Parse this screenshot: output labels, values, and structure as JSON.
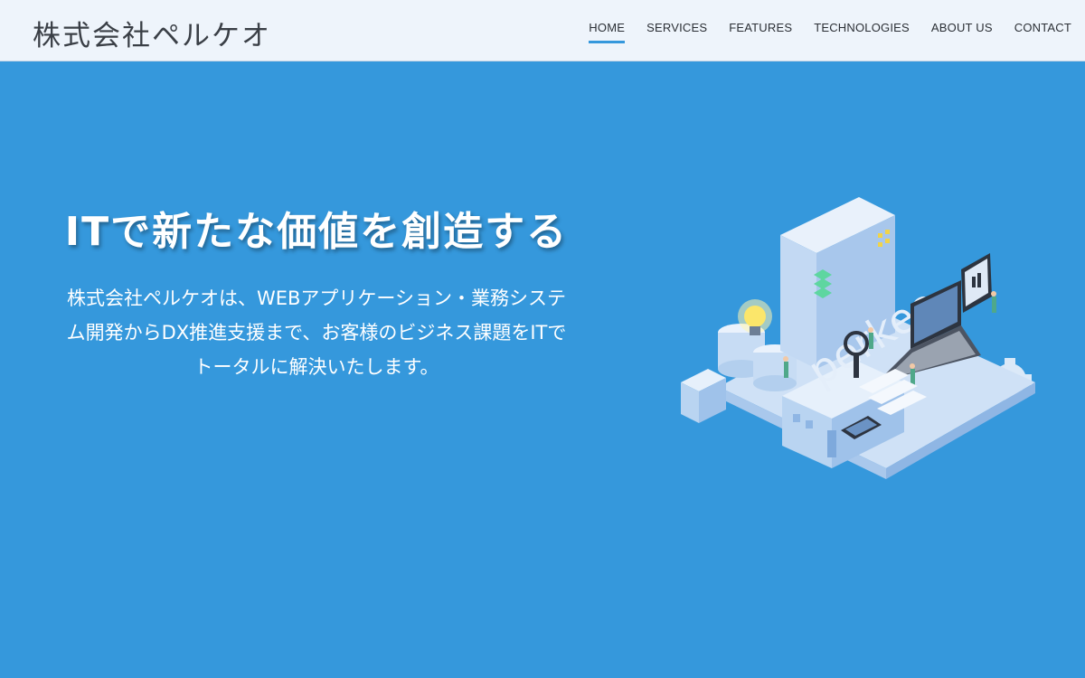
{
  "header": {
    "logo": "株式会社ペルケオ",
    "nav": [
      {
        "label": "HOME",
        "active": true
      },
      {
        "label": "SERVICES",
        "active": false
      },
      {
        "label": "FEATURES",
        "active": false
      },
      {
        "label": "TECHNOLOGIES",
        "active": false
      },
      {
        "label": "ABOUT US",
        "active": false
      },
      {
        "label": "CONTACT",
        "active": false
      }
    ]
  },
  "hero": {
    "title": "ITで新たな価値を創造する",
    "description_lines": [
      "株式会社ペルケオは、WEBアプリケーション・業務システ",
      "ム開発からDX推進支援まで、お客様のビジネス課題をITで",
      "トータルに解決いたします。"
    ],
    "illustration_label": "perkeo"
  },
  "colors": {
    "header_bg": "#eef4fb",
    "hero_bg": "#3598dc",
    "accent": "#3598dc"
  }
}
